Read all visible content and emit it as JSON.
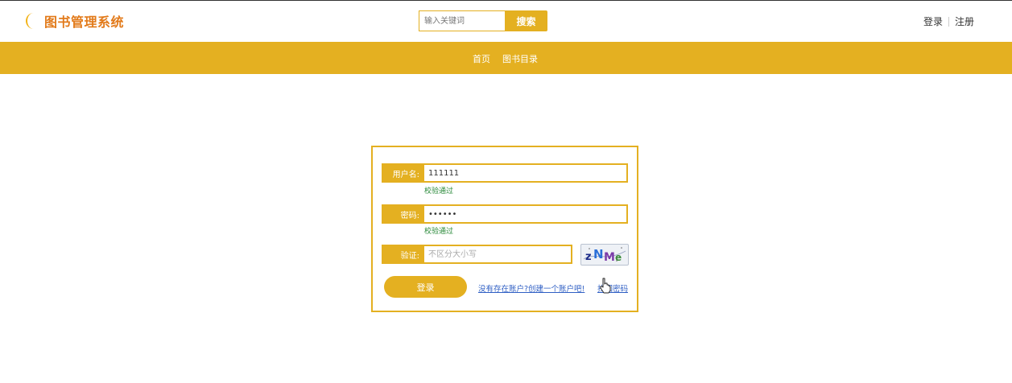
{
  "header": {
    "logo_text": "图书管理系统",
    "logo_icon": "moon-icon",
    "search": {
      "placeholder": "输入关键词",
      "button_label": "搜索"
    },
    "auth": {
      "login": "登录",
      "register": "注册"
    }
  },
  "nav": {
    "items": [
      {
        "label": "首页"
      },
      {
        "label": "图书目录"
      }
    ]
  },
  "login_form": {
    "username": {
      "label": "用户名:",
      "value": "111111",
      "status": "校验通过"
    },
    "password": {
      "label": "密码:",
      "value": "••••••",
      "status": "校验通过"
    },
    "captcha": {
      "label": "验证:",
      "placeholder": "不区分大小写",
      "image_text": "zNMe"
    },
    "submit_label": "登录",
    "register_link": "没有存在账户?创建一个账户吧!",
    "forgot_link": "找回密码"
  },
  "colors": {
    "accent": "#e4b021",
    "logo": "#e27a1a",
    "success": "#2a8a3a",
    "link": "#2f5fc4"
  }
}
